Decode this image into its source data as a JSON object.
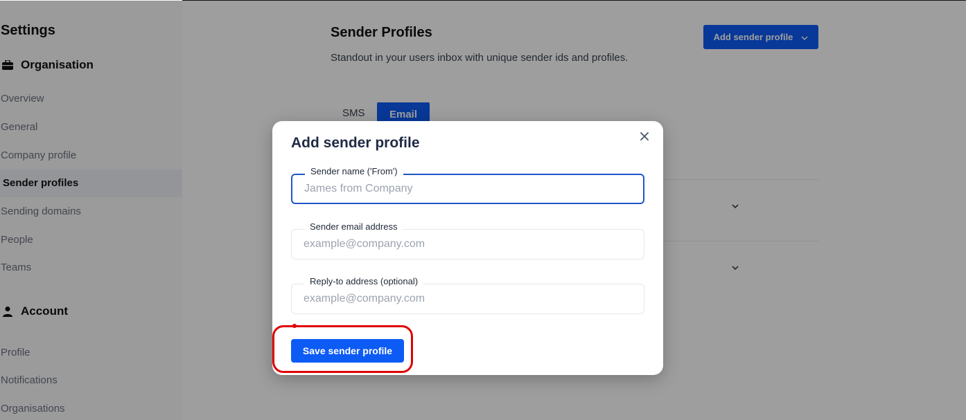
{
  "sidebar": {
    "title": "Settings",
    "organisation": {
      "heading": "Organisation",
      "icon": "briefcase-icon",
      "items": [
        {
          "label": "Overview"
        },
        {
          "label": "General"
        },
        {
          "label": "Company profile"
        },
        {
          "label": "Sender profiles",
          "active": true
        },
        {
          "label": "Sending domains"
        },
        {
          "label": "People"
        },
        {
          "label": "Teams"
        }
      ]
    },
    "account": {
      "heading": "Account",
      "icon": "user-icon",
      "items": [
        {
          "label": "Profile"
        },
        {
          "label": "Notifications"
        },
        {
          "label": "Organisations"
        }
      ]
    }
  },
  "main": {
    "title": "Sender Profiles",
    "subtitle": "Standout in your users inbox with unique sender ids and profiles.",
    "add_button_label": "Add sender profile",
    "tabs": [
      {
        "label": "SMS",
        "active": false
      },
      {
        "label": "Email",
        "active": true
      }
    ]
  },
  "modal": {
    "title": "Add sender profile",
    "close_icon": "close-icon",
    "fields": [
      {
        "label": "Sender name ('From')",
        "placeholder": "James from Company",
        "value": ""
      },
      {
        "label": "Sender email address",
        "placeholder": "example@company.com",
        "value": ""
      },
      {
        "label": "Reply-to address (optional)",
        "placeholder": "example@company.com",
        "value": ""
      }
    ],
    "save_button_label": "Save sender profile"
  },
  "colors": {
    "primary": "#0d5bf5",
    "focus_border": "#1f56c7",
    "highlight": "#e00000"
  }
}
